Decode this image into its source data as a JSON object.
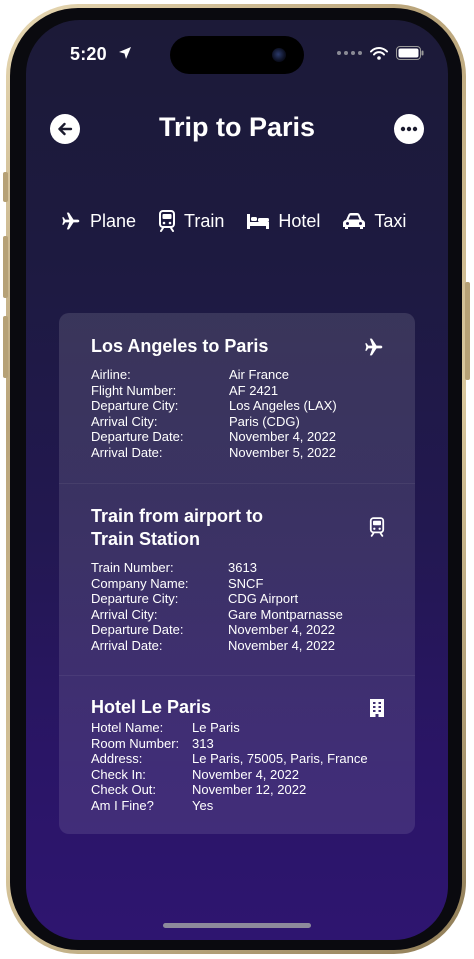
{
  "status_bar": {
    "time": "5:20"
  },
  "header": {
    "title": "Trip to Paris"
  },
  "tabs": [
    {
      "label": "Plane",
      "icon": "plane-icon"
    },
    {
      "label": "Train",
      "icon": "train-icon"
    },
    {
      "label": "Hotel",
      "icon": "bed-icon"
    },
    {
      "label": "Taxi",
      "icon": "car-icon"
    }
  ],
  "flight": {
    "title": "Los Angeles to Paris",
    "icon": "plane-icon",
    "rows": [
      {
        "key": "Airline:",
        "value": "Air France"
      },
      {
        "key": "Flight Number:",
        "value": "AF 2421"
      },
      {
        "key": "Departure City:",
        "value": "Los Angeles (LAX)"
      },
      {
        "key": "Arrival City:",
        "value": "Paris (CDG)"
      },
      {
        "key": "Departure Date:",
        "value": "November 4, 2022"
      },
      {
        "key": "Arrival Date:",
        "value": "November 5, 2022"
      }
    ]
  },
  "train": {
    "title_line1": "Train from airport to",
    "title_line2": "Train Station",
    "icon": "train-icon",
    "rows": [
      {
        "key": "Train Number:",
        "value": "3613"
      },
      {
        "key": "Company Name:",
        "value": "SNCF"
      },
      {
        "key": "Departure City:",
        "value": "CDG Airport"
      },
      {
        "key": "Arrival City:",
        "value": "Gare Montparnasse"
      },
      {
        "key": "Departure Date:",
        "value": "November 4, 2022"
      },
      {
        "key": "Arrival Date:",
        "value": "November 4, 2022"
      }
    ]
  },
  "hotel": {
    "title": "Hotel Le Paris",
    "icon": "building-icon",
    "rows": [
      {
        "key": "Hotel Name:",
        "value": "Le Paris"
      },
      {
        "key": "Room Number:",
        "value": "313"
      },
      {
        "key": "Address:",
        "value": "Le Paris, 75005, Paris, France"
      },
      {
        "key": "Check In:",
        "value": "November 4, 2022"
      },
      {
        "key": "Check Out:",
        "value": "November 12, 2022"
      },
      {
        "key": "Am I Fine?",
        "value": "Yes"
      }
    ]
  },
  "colors": {
    "background_top": "#1c1a38",
    "background_bottom": "#2e1570",
    "card": "rgba(255,255,255,0.12)",
    "frame_gold": "#c9b48a"
  }
}
